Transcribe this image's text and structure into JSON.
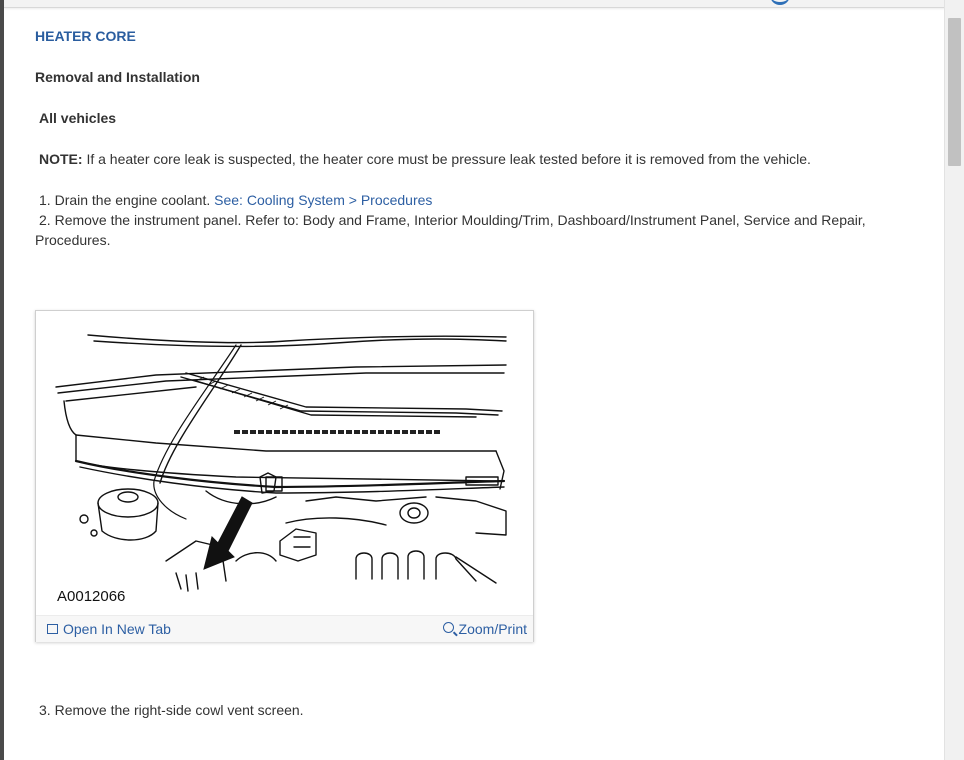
{
  "page": {
    "title": "HEATER CORE",
    "subtitle": "Removal and Installation",
    "section": "All vehicles",
    "note_label": "NOTE:",
    "note_text": " If a heater core leak is suspected, the heater core must be pressure leak tested before it is removed from the vehicle."
  },
  "steps": [
    {
      "number": "1.",
      "text": " Drain the engine coolant. ",
      "link": "See: Cooling System > Procedures"
    },
    {
      "number": "2.",
      "text": " Remove the instrument panel. Refer to: Body and Frame, Interior Moulding/Trim, Dashboard/Instrument Panel, Service and Repair,",
      "text_cont": "Procedures."
    },
    {
      "number": "3.",
      "text": " Remove the right-side cowl vent screen."
    }
  ],
  "figure": {
    "label": "A0012066",
    "open_tab": "Open In New Tab",
    "zoom": "Zoom/Print"
  },
  "colors": {
    "title": "#2a5d9f",
    "link": "#2d5fa3",
    "text": "#333333"
  },
  "icons": {
    "open_tab": "open-new-tab-icon",
    "zoom": "zoom-magnifier-icon"
  }
}
